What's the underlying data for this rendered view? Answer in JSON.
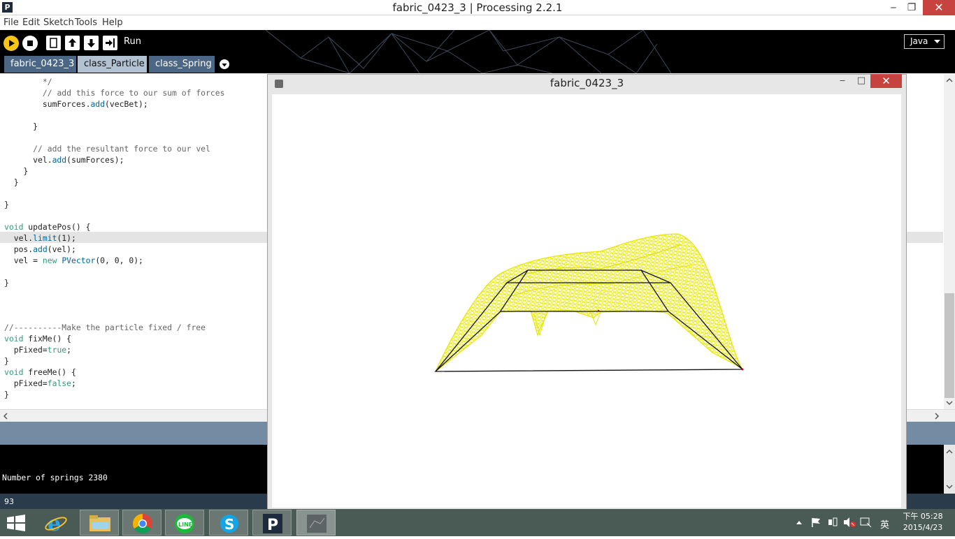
{
  "window": {
    "title": "fabric_0423_3 | Processing 2.2.1",
    "app_icon_letter": "P",
    "minimize": "‒",
    "maximize": "❐",
    "close": "✕"
  },
  "menu": [
    "File",
    "Edit",
    "Sketch",
    "Tools",
    "Help"
  ],
  "toolbar": {
    "run_label": "Run",
    "mode": "Java"
  },
  "tabs": [
    {
      "label": "fabric_0423_3",
      "active": false
    },
    {
      "label": "class_Particle",
      "active": true
    },
    {
      "label": "class_Spring",
      "active": false
    }
  ],
  "editor": {
    "lines": [
      "        */",
      "        // add this force to our sum of forces",
      "        sumForces.add(vecBet);",
      "",
      "      }",
      "",
      "      // add the resultant force to our vel",
      "      vel.add(sumForces);",
      "    }",
      "  }",
      "",
      "}",
      "",
      "void updatePos() {",
      "  vel.limit(1);",
      "  pos.add(vel);",
      "  vel = new PVector(0, 0, 0);",
      "",
      "}",
      "",
      "",
      "",
      "//----------Make the particle fixed / free",
      "void fixMe() {",
      "  pFixed=true;",
      "}",
      "void freeMe() {",
      "  pFixed=false;",
      "}"
    ],
    "highlighted_line": "  vel.limit(1);"
  },
  "console": {
    "output": "Number of springs 2380",
    "line_number": "93"
  },
  "sketch": {
    "title": "fabric_0423_3"
  },
  "taskbar": {
    "apps": [
      "start",
      "internet-explorer",
      "file-explorer",
      "chrome",
      "line",
      "skype",
      "processing",
      "sketch-window"
    ],
    "clock_time": "下午 05:28",
    "clock_date": "2015/4/23",
    "ime": "英"
  },
  "colors": {
    "toolbar_bg": "#000000",
    "run_button": "#f6c518",
    "tab_active": "#b3c2d3",
    "tab_inactive": "#4c6686",
    "message_bar": "#748ca3",
    "mesh": "#e8e800",
    "close_red": "#c7433f"
  }
}
